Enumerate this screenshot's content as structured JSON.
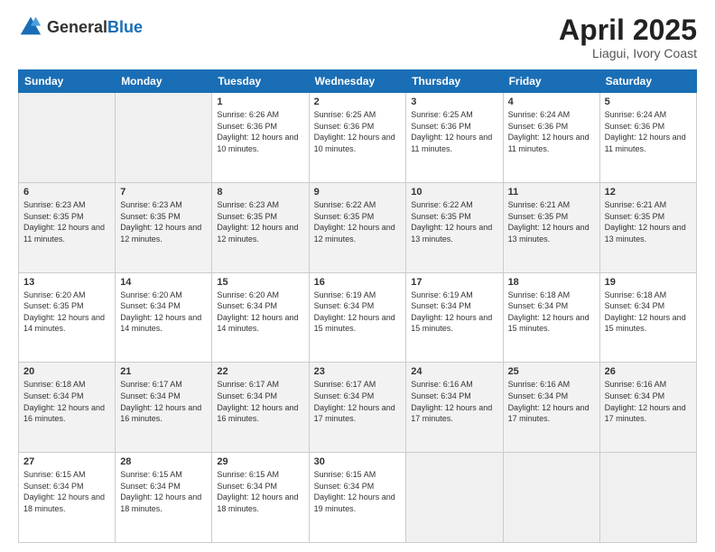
{
  "header": {
    "logo_general": "General",
    "logo_blue": "Blue",
    "title": "April 2025",
    "subtitle": "Liagui, Ivory Coast"
  },
  "days_of_week": [
    "Sunday",
    "Monday",
    "Tuesday",
    "Wednesday",
    "Thursday",
    "Friday",
    "Saturday"
  ],
  "weeks": [
    [
      {
        "day": "",
        "info": ""
      },
      {
        "day": "",
        "info": ""
      },
      {
        "day": "1",
        "info": "Sunrise: 6:26 AM\nSunset: 6:36 PM\nDaylight: 12 hours and 10 minutes."
      },
      {
        "day": "2",
        "info": "Sunrise: 6:25 AM\nSunset: 6:36 PM\nDaylight: 12 hours and 10 minutes."
      },
      {
        "day": "3",
        "info": "Sunrise: 6:25 AM\nSunset: 6:36 PM\nDaylight: 12 hours and 11 minutes."
      },
      {
        "day": "4",
        "info": "Sunrise: 6:24 AM\nSunset: 6:36 PM\nDaylight: 12 hours and 11 minutes."
      },
      {
        "day": "5",
        "info": "Sunrise: 6:24 AM\nSunset: 6:36 PM\nDaylight: 12 hours and 11 minutes."
      }
    ],
    [
      {
        "day": "6",
        "info": "Sunrise: 6:23 AM\nSunset: 6:35 PM\nDaylight: 12 hours and 11 minutes."
      },
      {
        "day": "7",
        "info": "Sunrise: 6:23 AM\nSunset: 6:35 PM\nDaylight: 12 hours and 12 minutes."
      },
      {
        "day": "8",
        "info": "Sunrise: 6:23 AM\nSunset: 6:35 PM\nDaylight: 12 hours and 12 minutes."
      },
      {
        "day": "9",
        "info": "Sunrise: 6:22 AM\nSunset: 6:35 PM\nDaylight: 12 hours and 12 minutes."
      },
      {
        "day": "10",
        "info": "Sunrise: 6:22 AM\nSunset: 6:35 PM\nDaylight: 12 hours and 13 minutes."
      },
      {
        "day": "11",
        "info": "Sunrise: 6:21 AM\nSunset: 6:35 PM\nDaylight: 12 hours and 13 minutes."
      },
      {
        "day": "12",
        "info": "Sunrise: 6:21 AM\nSunset: 6:35 PM\nDaylight: 12 hours and 13 minutes."
      }
    ],
    [
      {
        "day": "13",
        "info": "Sunrise: 6:20 AM\nSunset: 6:35 PM\nDaylight: 12 hours and 14 minutes."
      },
      {
        "day": "14",
        "info": "Sunrise: 6:20 AM\nSunset: 6:34 PM\nDaylight: 12 hours and 14 minutes."
      },
      {
        "day": "15",
        "info": "Sunrise: 6:20 AM\nSunset: 6:34 PM\nDaylight: 12 hours and 14 minutes."
      },
      {
        "day": "16",
        "info": "Sunrise: 6:19 AM\nSunset: 6:34 PM\nDaylight: 12 hours and 15 minutes."
      },
      {
        "day": "17",
        "info": "Sunrise: 6:19 AM\nSunset: 6:34 PM\nDaylight: 12 hours and 15 minutes."
      },
      {
        "day": "18",
        "info": "Sunrise: 6:18 AM\nSunset: 6:34 PM\nDaylight: 12 hours and 15 minutes."
      },
      {
        "day": "19",
        "info": "Sunrise: 6:18 AM\nSunset: 6:34 PM\nDaylight: 12 hours and 15 minutes."
      }
    ],
    [
      {
        "day": "20",
        "info": "Sunrise: 6:18 AM\nSunset: 6:34 PM\nDaylight: 12 hours and 16 minutes."
      },
      {
        "day": "21",
        "info": "Sunrise: 6:17 AM\nSunset: 6:34 PM\nDaylight: 12 hours and 16 minutes."
      },
      {
        "day": "22",
        "info": "Sunrise: 6:17 AM\nSunset: 6:34 PM\nDaylight: 12 hours and 16 minutes."
      },
      {
        "day": "23",
        "info": "Sunrise: 6:17 AM\nSunset: 6:34 PM\nDaylight: 12 hours and 17 minutes."
      },
      {
        "day": "24",
        "info": "Sunrise: 6:16 AM\nSunset: 6:34 PM\nDaylight: 12 hours and 17 minutes."
      },
      {
        "day": "25",
        "info": "Sunrise: 6:16 AM\nSunset: 6:34 PM\nDaylight: 12 hours and 17 minutes."
      },
      {
        "day": "26",
        "info": "Sunrise: 6:16 AM\nSunset: 6:34 PM\nDaylight: 12 hours and 17 minutes."
      }
    ],
    [
      {
        "day": "27",
        "info": "Sunrise: 6:15 AM\nSunset: 6:34 PM\nDaylight: 12 hours and 18 minutes."
      },
      {
        "day": "28",
        "info": "Sunrise: 6:15 AM\nSunset: 6:34 PM\nDaylight: 12 hours and 18 minutes."
      },
      {
        "day": "29",
        "info": "Sunrise: 6:15 AM\nSunset: 6:34 PM\nDaylight: 12 hours and 18 minutes."
      },
      {
        "day": "30",
        "info": "Sunrise: 6:15 AM\nSunset: 6:34 PM\nDaylight: 12 hours and 19 minutes."
      },
      {
        "day": "",
        "info": ""
      },
      {
        "day": "",
        "info": ""
      },
      {
        "day": "",
        "info": ""
      }
    ]
  ]
}
